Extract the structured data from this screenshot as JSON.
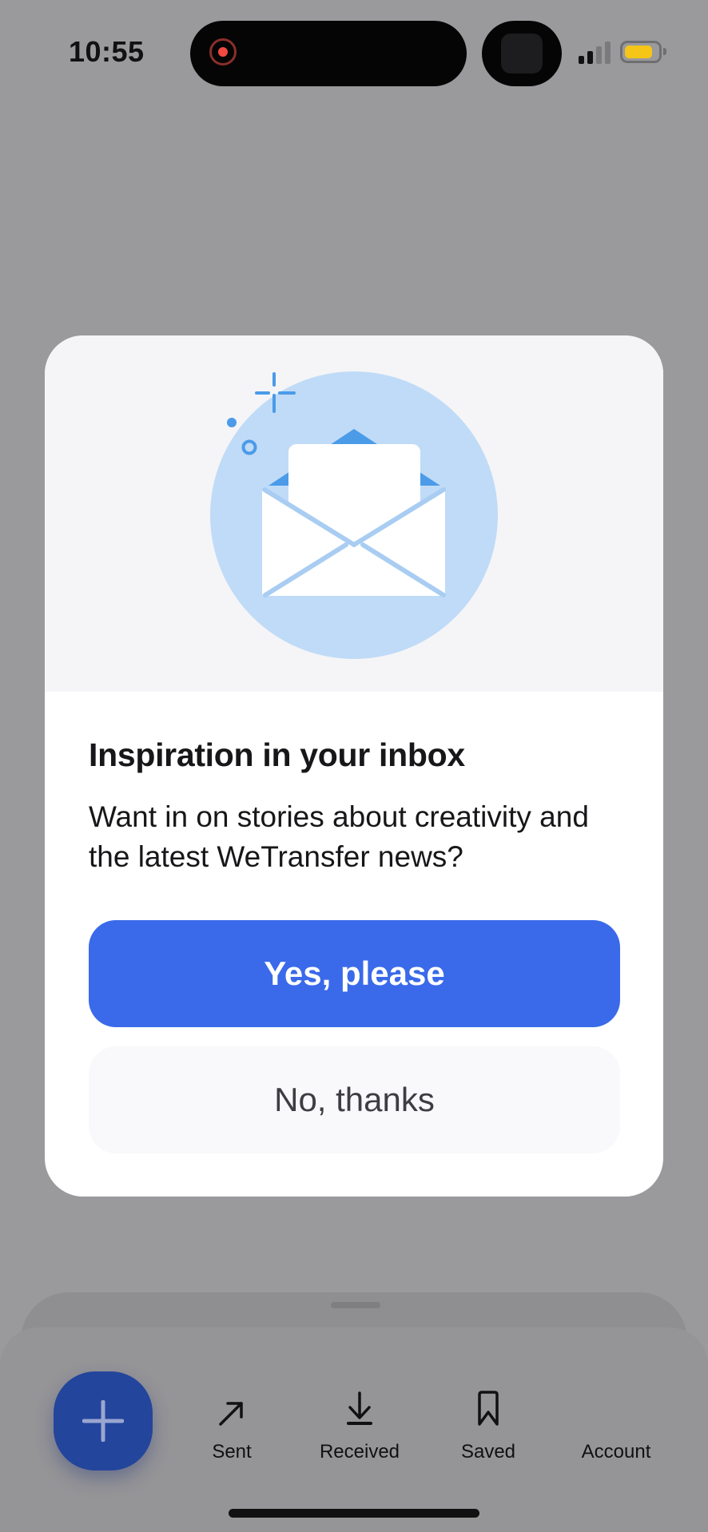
{
  "status_bar": {
    "time": "10:55",
    "recording_indicator": "screen-recording",
    "signal_bars_active": 2,
    "signal_bars_total": 4,
    "battery_level": 0.75,
    "battery_color": "#f5c518"
  },
  "modal": {
    "illustration": "open-envelope-icon",
    "title": "Inspiration in your inbox",
    "description": "Want in on stories about creativity and the latest WeTransfer news?",
    "primary_button": "Yes, please",
    "secondary_button": "No, thanks",
    "accent_color": "#3a6aea"
  },
  "bottom_nav": {
    "fab_icon": "plus-icon",
    "items": [
      {
        "label": "Sent",
        "icon": "arrow-up-right-icon"
      },
      {
        "label": "Received",
        "icon": "download-icon"
      },
      {
        "label": "Saved",
        "icon": "bookmark-icon"
      },
      {
        "label": "Account",
        "icon": ""
      }
    ]
  }
}
